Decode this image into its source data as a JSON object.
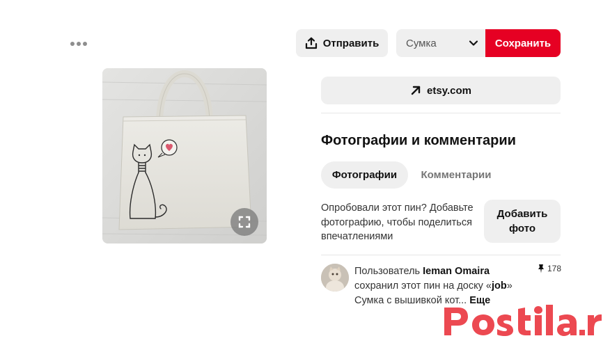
{
  "toolbar": {
    "send_label": "Отправить",
    "board_select_value": "Сумка",
    "save_label": "Сохранить"
  },
  "link": {
    "label": "etsy.com"
  },
  "photos_section": {
    "title": "Фотографии и комментарии",
    "tabs": [
      {
        "label": "Фотографии",
        "active": true
      },
      {
        "label": "Комментарии",
        "active": false
      }
    ],
    "try_text": "Опробовали этот пин? Добавьте фотографию, чтобы поделиться впечатлениями",
    "add_photo_line1": "Добавить",
    "add_photo_line2": "фото"
  },
  "activity": {
    "prefix": "Пользователь ",
    "user_name": "Ieman Omaira",
    "saved_text": " сохранил этот пин на доску ",
    "board_open_quote": "«",
    "board_name": "job",
    "board_close_quote": "»",
    "description": "Сумка с вышивкой кот...",
    "more_label": "Еще",
    "pin_count": "178"
  },
  "colors": {
    "accent": "#e60023",
    "button_bg": "#efefef",
    "watermark": "#e8222c"
  },
  "icons": {
    "more": "more-dots-icon",
    "share": "share-upload-icon",
    "chevron": "chevron-down-icon",
    "external": "arrow-up-right-icon",
    "expand": "expand-icon",
    "pin": "pushpin-icon"
  }
}
